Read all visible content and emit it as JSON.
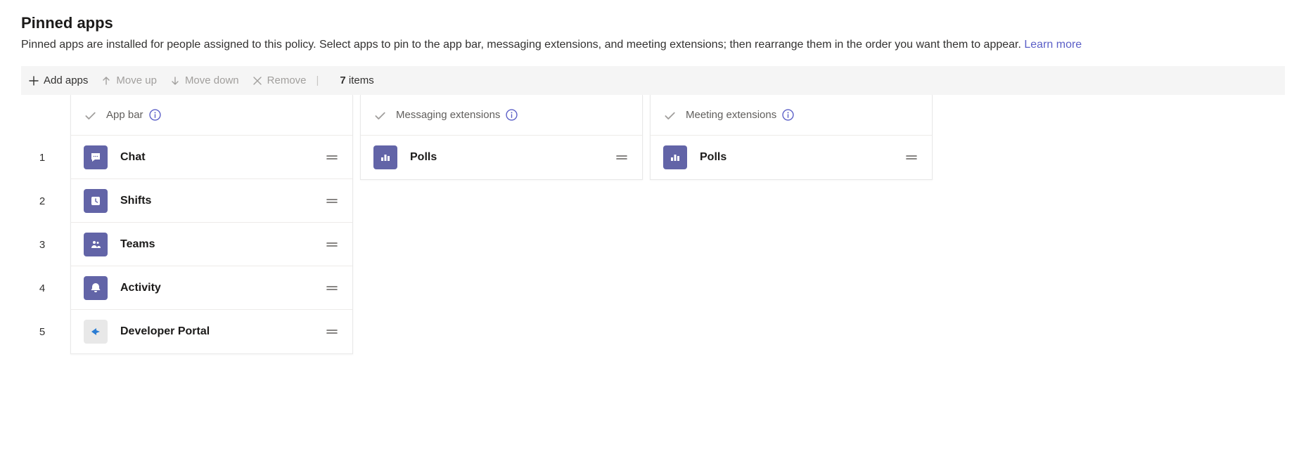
{
  "header": {
    "title": "Pinned apps",
    "description_pre": "Pinned apps are installed for people assigned to this policy. Select apps to pin to the app bar, messaging extensions, and meeting extensions; then rearrange them in the order you want them to appear. ",
    "learn_more": "Learn more"
  },
  "toolbar": {
    "add": "Add apps",
    "move_up": "Move up",
    "move_down": "Move down",
    "remove": "Remove",
    "count_num": "7",
    "count_label": " items"
  },
  "columns": {
    "app_bar": {
      "title": "App bar",
      "items": [
        {
          "n": "1",
          "name": "Chat",
          "tile": "purple",
          "icon": "chat"
        },
        {
          "n": "2",
          "name": "Shifts",
          "tile": "purple",
          "icon": "shifts"
        },
        {
          "n": "3",
          "name": "Teams",
          "tile": "purple",
          "icon": "teams"
        },
        {
          "n": "4",
          "name": "Activity",
          "tile": "purple",
          "icon": "activity"
        },
        {
          "n": "5",
          "name": "Developer Portal",
          "tile": "light",
          "icon": "dev"
        }
      ]
    },
    "messaging": {
      "title": "Messaging extensions",
      "items": [
        {
          "name": "Polls",
          "tile": "purple",
          "icon": "polls"
        }
      ]
    },
    "meeting": {
      "title": "Meeting extensions",
      "items": [
        {
          "name": "Polls",
          "tile": "purple",
          "icon": "polls"
        }
      ]
    }
  }
}
